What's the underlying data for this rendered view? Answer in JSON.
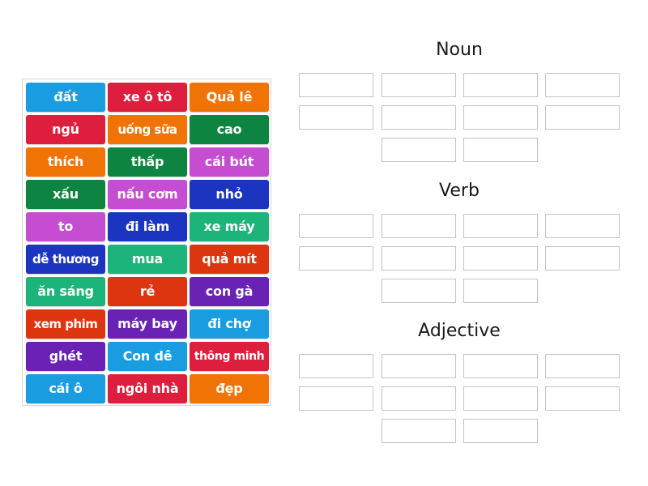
{
  "tile_bank": {
    "tiles": [
      {
        "label": "đất",
        "color": "#1a9de0"
      },
      {
        "label": "xe ô tô",
        "color": "#dd1e3c"
      },
      {
        "label": "Quả lê",
        "color": "#f07306"
      },
      {
        "label": "ngủ",
        "color": "#dd1e3c"
      },
      {
        "label": "uống sữa",
        "color": "#f07306"
      },
      {
        "label": "cao",
        "color": "#0d8540"
      },
      {
        "label": "thích",
        "color": "#f07306"
      },
      {
        "label": "thấp",
        "color": "#0d8540"
      },
      {
        "label": "cái bút",
        "color": "#c54dd1"
      },
      {
        "label": "xấu",
        "color": "#0d8540"
      },
      {
        "label": "nấu cơm",
        "color": "#c54dd1"
      },
      {
        "label": "nhỏ",
        "color": "#1b35c0"
      },
      {
        "label": "to",
        "color": "#c54dd1"
      },
      {
        "label": "đi làm",
        "color": "#1b35c0"
      },
      {
        "label": "xe máy",
        "color": "#1cb47a"
      },
      {
        "label": "dễ thương",
        "color": "#1b35c0"
      },
      {
        "label": "mua",
        "color": "#1cb47a"
      },
      {
        "label": "quả mít",
        "color": "#dd3510"
      },
      {
        "label": "ăn sáng",
        "color": "#1cb47a"
      },
      {
        "label": "rẻ",
        "color": "#dd3510"
      },
      {
        "label": "con gà",
        "color": "#6a22b5"
      },
      {
        "label": "xem phim",
        "color": "#dd3510"
      },
      {
        "label": "máy bay",
        "color": "#6a22b5"
      },
      {
        "label": "đi chợ",
        "color": "#1a9de0"
      },
      {
        "label": "ghét",
        "color": "#6a22b5"
      },
      {
        "label": "Con dê",
        "color": "#1a9de0"
      },
      {
        "label": "thông minh",
        "color": "#dd1e3c"
      },
      {
        "label": "cái ô",
        "color": "#1a9de0"
      },
      {
        "label": "ngôi nhà",
        "color": "#dd1e3c"
      },
      {
        "label": "đẹp",
        "color": "#f07306"
      }
    ]
  },
  "groups": [
    {
      "title": "Noun",
      "slot_count": 10
    },
    {
      "title": "Verb",
      "slot_count": 10
    },
    {
      "title": "Adjective",
      "slot_count": 10
    }
  ]
}
